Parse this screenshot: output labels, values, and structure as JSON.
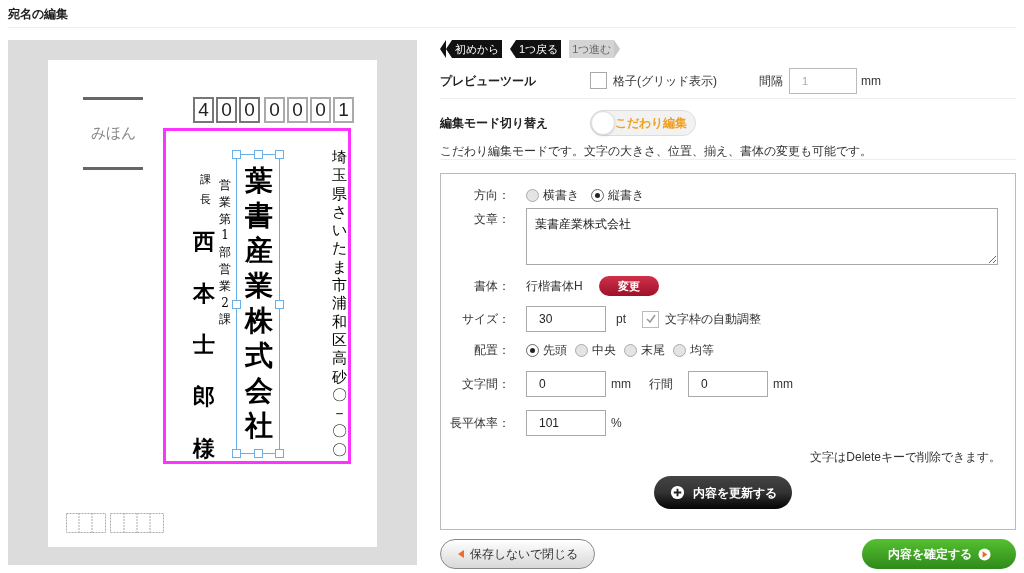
{
  "title": "宛名の編集",
  "postcard": {
    "postal_code": [
      "4",
      "0",
      "0",
      "0",
      "0",
      "0",
      "1"
    ],
    "sample_label": "みほん",
    "address": "埼玉県さいたま市浦和区高砂〇－〇〇",
    "company": "葉書産業株式会社",
    "department": "営業第1部営業2課",
    "job_title": "課長",
    "name": "西本士郎様"
  },
  "history": [
    {
      "label": "初めから",
      "kind": "first",
      "disabled": false
    },
    {
      "label": "1つ戻る",
      "kind": "back",
      "disabled": false
    },
    {
      "label": "1つ進む",
      "kind": "forward",
      "disabled": true
    }
  ],
  "preview_tool": {
    "label": "プレビューツール",
    "grid": {
      "label": "格子(グリッド表示)",
      "checked": false
    },
    "spacing_label": "間隔",
    "spacing_placeholder": "1",
    "unit": "mm"
  },
  "edit_mode": {
    "label": "編集モード切り替え",
    "toggle_label": "こだわり編集",
    "on": true,
    "description": "こだわり編集モードです。文字の大きさ、位置、揃え、書体の変更も可能です。"
  },
  "form": {
    "direction": {
      "label": "方向：",
      "options": [
        {
          "label": "横書き",
          "selected": false
        },
        {
          "label": "縦書き",
          "selected": true
        }
      ]
    },
    "text": {
      "label": "文章：",
      "value": "葉書産業株式会社"
    },
    "font": {
      "label": "書体：",
      "value": "行楷書体H",
      "button": "変更"
    },
    "size": {
      "label": "サイズ：",
      "value": "30",
      "unit": "pt",
      "auto_fit": {
        "label": "文字枠の自動調整",
        "checked": true
      }
    },
    "align": {
      "label": "配置：",
      "options": [
        {
          "label": "先頭",
          "selected": true
        },
        {
          "label": "中央",
          "selected": false
        },
        {
          "label": "末尾",
          "selected": false
        },
        {
          "label": "均等",
          "selected": false
        }
      ]
    },
    "char_spacing": {
      "label": "文字間：",
      "value": "0",
      "unit": "mm"
    },
    "line_spacing": {
      "label": "行間",
      "value": "0",
      "unit": "mm"
    },
    "aspect": {
      "label": "長平体率：",
      "value": "101",
      "unit": "%"
    },
    "note": "文字はDeleteキーで削除できます。",
    "update_button": "内容を更新する"
  },
  "close_button": "保存しないで閉じる",
  "confirm_button": "内容を確定する"
}
